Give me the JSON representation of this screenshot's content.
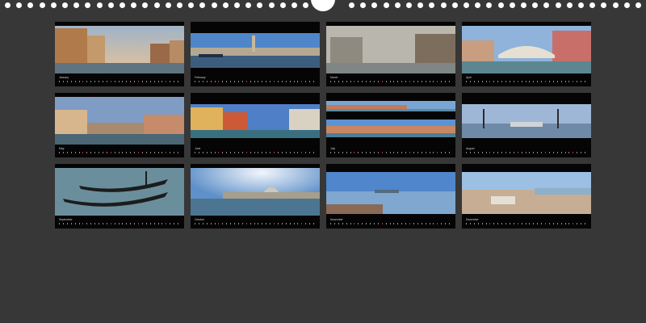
{
  "colors": {
    "backdrop": "#373737",
    "panel": "#050505",
    "binding_holes": "#ffffff",
    "sunday_marks": "#b33030"
  },
  "months": [
    {
      "label": "January",
      "photo": "canal-palazzo-sunset",
      "photo_layout": "full"
    },
    {
      "label": "February",
      "photo": "piazzetta-panorama",
      "photo_layout": "band"
    },
    {
      "label": "March",
      "photo": "foggy-canal",
      "photo_layout": "full"
    },
    {
      "label": "April",
      "photo": "rialto-bridge",
      "photo_layout": "full"
    },
    {
      "label": "May",
      "photo": "grand-canal-morning",
      "photo_layout": "full"
    },
    {
      "label": "June",
      "photo": "colourful-palazzi",
      "photo_layout": "full"
    },
    {
      "label": "July",
      "photo": "double-strip-panorama",
      "photo_layout": "double"
    },
    {
      "label": "August",
      "photo": "lamp-posts-waterfront",
      "photo_layout": "band"
    },
    {
      "label": "September",
      "photo": "gondolas",
      "photo_layout": "full"
    },
    {
      "label": "October",
      "photo": "salute-church-sun",
      "photo_layout": "full"
    },
    {
      "label": "November",
      "photo": "lagoon-view",
      "photo_layout": "full"
    },
    {
      "label": "December",
      "photo": "rooftops-panorama",
      "photo_layout": "full"
    }
  ]
}
